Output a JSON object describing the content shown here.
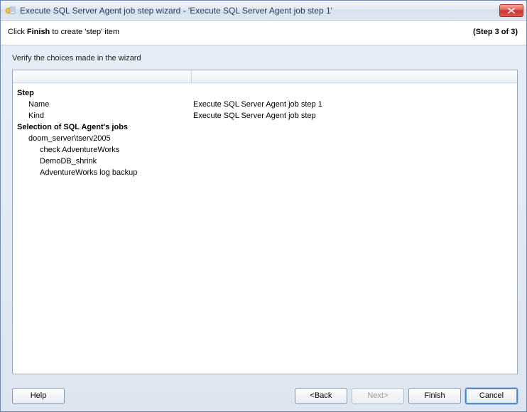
{
  "window": {
    "title": "Execute SQL Server Agent job step wizard - 'Execute SQL Server Agent job step 1'"
  },
  "header": {
    "instruction_prefix": "Click ",
    "instruction_bold": "Finish",
    "instruction_suffix": " to create 'step' item",
    "step_indicator": "(Step 3 of 3)"
  },
  "subheader": "Verify the choices made in the wizard",
  "summary": {
    "step_heading": "Step",
    "name_label": "Name",
    "name_value": "Execute SQL Server Agent job step 1",
    "kind_label": "Kind",
    "kind_value": "Execute SQL Server Agent job step",
    "selection_heading": "Selection of SQL Agent's jobs",
    "server": "doom_server\\tserv2005",
    "jobs": [
      "check AdventureWorks",
      "DemoDB_shrink",
      "AdventureWorks log backup"
    ]
  },
  "footer": {
    "help": "Help",
    "back": "<Back",
    "next": "Next>",
    "finish": "Finish",
    "cancel": "Cancel"
  }
}
